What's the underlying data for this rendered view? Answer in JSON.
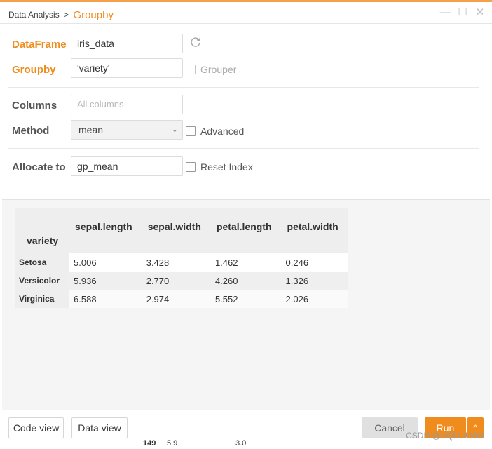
{
  "header": {
    "breadcrumb_parent": "Data Analysis",
    "breadcrumb_sep": ">",
    "breadcrumb_current": "Groupby",
    "minimize_icon": "—",
    "maximize_icon": "☐",
    "close_icon": "✕"
  },
  "form": {
    "dataframe_label": "DataFrame",
    "dataframe_value": "iris_data",
    "groupby_label": "Groupby",
    "groupby_value": "'variety'",
    "grouper_label": "Grouper",
    "columns_label": "Columns",
    "columns_placeholder": "All columns",
    "method_label": "Method",
    "method_value": "mean",
    "advanced_label": "Advanced",
    "allocate_label": "Allocate to",
    "allocate_value": "gp_mean",
    "reset_index_label": "Reset Index"
  },
  "result": {
    "columns": [
      "sepal.length",
      "sepal.width",
      "petal.length",
      "petal.width"
    ],
    "index_name": "variety",
    "rows": [
      {
        "index": "Setosa",
        "values": [
          "5.006",
          "3.428",
          "1.462",
          "0.246"
        ]
      },
      {
        "index": "Versicolor",
        "values": [
          "5.936",
          "2.770",
          "4.260",
          "1.326"
        ]
      },
      {
        "index": "Virginica",
        "values": [
          "6.588",
          "2.974",
          "5.552",
          "2.026"
        ]
      }
    ]
  },
  "footer": {
    "code_view": "Code view",
    "data_view": "Data view",
    "cancel": "Cancel",
    "run": "Run",
    "run_more": "^"
  },
  "background_peek": {
    "index": "149",
    "v1": "5.9",
    "v2": "3.0"
  },
  "watermark": "CSDN @UQI-LIUWJ",
  "colors": {
    "accent": "#f08c1e",
    "topbar": "#f5a04a"
  }
}
